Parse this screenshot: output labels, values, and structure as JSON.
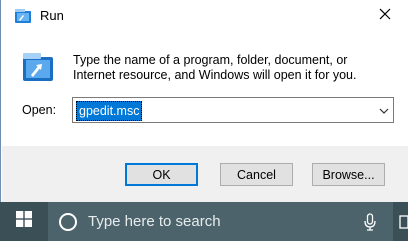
{
  "window": {
    "title": "Run",
    "close_glyph": "✕"
  },
  "message": "Type the name of a program, folder, document, or Internet resource, and Windows will open it for you.",
  "open": {
    "label": "Open:",
    "value": "gpedit.msc"
  },
  "buttons": {
    "ok": "OK",
    "cancel": "Cancel",
    "browse": "Browse..."
  },
  "taskbar": {
    "search_placeholder": "Type here to search"
  },
  "colors": {
    "accent": "#0078d7",
    "taskbar": "#3b4f57",
    "footer": "#f0f0f0"
  },
  "icons": [
    "run-icon",
    "close-icon",
    "run-large-icon",
    "chevron-down-icon",
    "windows-logo-icon",
    "search-circle-icon",
    "microphone-icon"
  ]
}
